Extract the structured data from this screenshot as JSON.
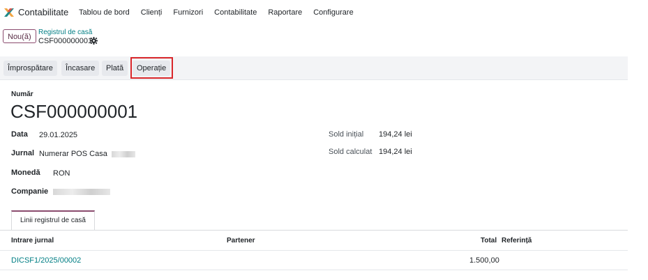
{
  "nav": {
    "app_name": "Contabilitate",
    "menu": [
      "Tablou de bord",
      "Clienți",
      "Furnizori",
      "Contabilitate",
      "Raportare",
      "Configurare"
    ]
  },
  "control": {
    "new_label": "Nou(ă)",
    "breadcrumb_parent": "Registrul de casă",
    "breadcrumb_current": "CSF000000001"
  },
  "buttons": [
    "Împrospătare",
    "Încasare",
    "Plată",
    "Operație"
  ],
  "form": {
    "number_label": "Număr",
    "number": "CSF000000001",
    "date_label": "Data",
    "date": "29.01.2025",
    "journal_label": "Jurnal",
    "journal": "Numerar POS Casa",
    "currency_label": "Monedă",
    "currency": "RON",
    "company_label": "Companie",
    "opening_label": "Sold inițial",
    "opening": "194,24 lei",
    "computed_label": "Sold calculat",
    "computed": "194,24 lei"
  },
  "tab": {
    "label": "Linii registrul de casă"
  },
  "table": {
    "headers": {
      "entry": "Intrare jurnal",
      "partner": "Partener",
      "total": "Total",
      "reference": "Referință"
    },
    "rows": [
      {
        "entry": "DICSF1/2025/00002",
        "partner": "",
        "total": "1.500,00",
        "reference": ""
      }
    ]
  },
  "colors": {
    "brand": "#8a4b6e",
    "link": "#017e84",
    "highlight": "#d9262a"
  }
}
